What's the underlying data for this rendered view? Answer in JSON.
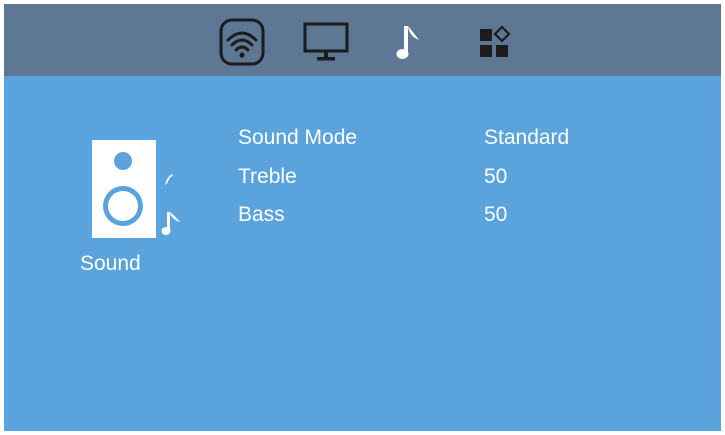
{
  "topbar": {
    "tabs": [
      {
        "icon": "wifi-icon",
        "label": "Network",
        "selected": true
      },
      {
        "icon": "monitor-icon",
        "label": "Display",
        "selected": false
      },
      {
        "icon": "music-note-icon",
        "label": "Sound",
        "selected": false
      },
      {
        "icon": "apps-icon",
        "label": "Apps",
        "selected": false
      }
    ]
  },
  "panel": {
    "icon": "speaker-icon",
    "title": "Sound"
  },
  "settings": [
    {
      "label": "Sound Mode",
      "value": "Standard"
    },
    {
      "label": "Treble",
      "value": "50"
    },
    {
      "label": "Bass",
      "value": "50"
    }
  ],
  "colors": {
    "background": "#5aa3dc",
    "topbar": "#5d7795",
    "text": "#ffffff",
    "icon_dark": "#1c1c1c"
  }
}
